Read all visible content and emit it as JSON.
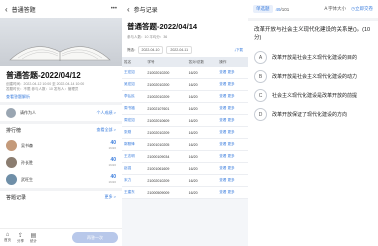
{
  "panel1": {
    "title": "普通答题",
    "name": "普通答题-2022/04/12",
    "meta_line1": "创建时间：2022-04-12 10:00 至 2022-04-14 10:00",
    "meta_line2": "答题时长：不限  参与人数：10  发布人：管理员",
    "link": "查看答题解析",
    "user": "请作为人",
    "user_status": "个人成绩 >",
    "ranking_title": "排行榜",
    "ranking_more": "查看全部 >",
    "ranking": [
      {
        "name": "吴书森",
        "score": "40",
        "sub": "16/20"
      },
      {
        "name": "孙长胜",
        "score": "40",
        "sub": "16/20"
      },
      {
        "name": "武旺生",
        "score": "40",
        "sub": "16/20"
      }
    ],
    "record_title": "答题记录",
    "record_more": "更多 >",
    "bottom": [
      {
        "icon": "⌂",
        "label": "首页"
      },
      {
        "icon": "⇪",
        "label": "分享"
      },
      {
        "icon": "▤",
        "label": "统计"
      }
    ],
    "retake": "再答一次"
  },
  "panel2": {
    "title": "参与记录",
    "name": "普通答题-2022/04/14",
    "info": "参与人数：10   平均分：36",
    "filter_label": "筛选：",
    "date_from": "2022-04-10",
    "date_to": "2022-04-11",
    "download": "下载",
    "columns": [
      "姓名",
      "学号",
      "答对/总数",
      "操作"
    ],
    "rows": [
      {
        "name": "王宏如",
        "id": "21002010200",
        "score": "16/20"
      },
      {
        "name": "吴宏如",
        "id": "21002010200",
        "score": "16/20"
      },
      {
        "name": "李弘民",
        "id": "21002010209",
        "score": "16/20"
      },
      {
        "name": "周书福",
        "id": "21002107601",
        "score": "16/20"
      },
      {
        "name": "周宏如",
        "id": "21002010609",
        "score": "16/20"
      },
      {
        "name": "张刚",
        "id": "21002010209",
        "score": "16/20"
      },
      {
        "name": "郭照锋",
        "id": "21001010205",
        "score": "16/20"
      },
      {
        "name": "王志明",
        "id": "21000109034",
        "score": "16/20"
      },
      {
        "name": "赵强",
        "id": "21001061609",
        "score": "16/20"
      },
      {
        "name": "宋力",
        "id": "21002010209",
        "score": "16/20"
      },
      {
        "name": "王建东",
        "id": "21000509009",
        "score": "16/20"
      }
    ],
    "op_view": "查看",
    "op_more": "更多"
  },
  "panel3": {
    "qtype": "单选题",
    "progress": "49",
    "total": "/101",
    "font": "字体大小",
    "submit": "立即交卷",
    "question": "改革开放与社会主义现代化建设的关系是()。(10分)",
    "options": [
      {
        "letter": "A",
        "text": "改革开放是社会主义现代化建设的目的"
      },
      {
        "letter": "B",
        "text": "改革开放是社会主义现代化建设的动力"
      },
      {
        "letter": "C",
        "text": "社会主义现代化建设是改革开放的前提"
      },
      {
        "letter": "D",
        "text": "改革开放保证了现代化建设的方向"
      }
    ]
  }
}
